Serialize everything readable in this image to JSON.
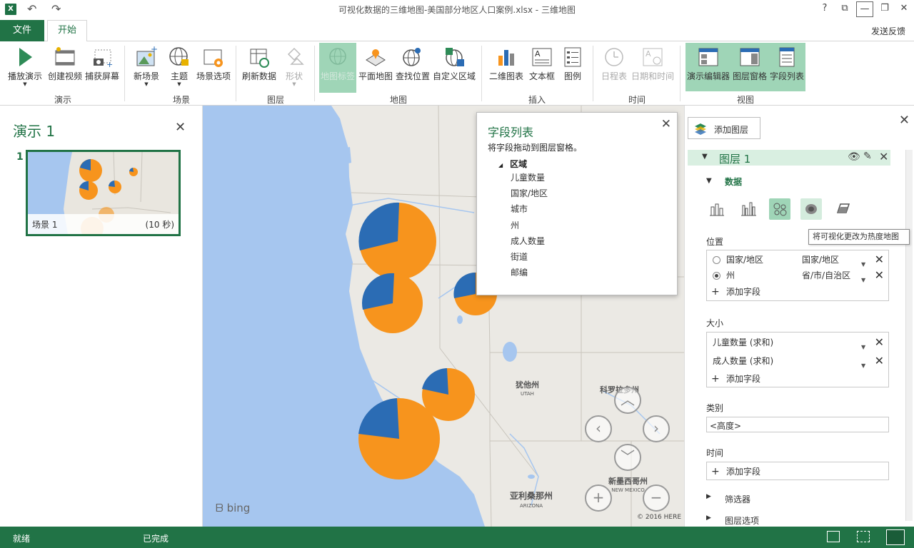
{
  "window": {
    "title": "可视化数据的三维地图-美国部分地区人口案例.xlsx - 三维地图",
    "help": "?",
    "app_icon": "X"
  },
  "tabs": {
    "file": "文件",
    "home": "开始",
    "feedback": "发送反馈"
  },
  "ribbon": {
    "groups": {
      "tour": "演示",
      "scene": "场景",
      "layer": "图层",
      "map": "地图",
      "insert": "插入",
      "time": "时间",
      "view": "视图"
    },
    "buttons": {
      "play_tour": "播放演示",
      "create_video": "创建视频",
      "capture_screen": "捕获屏幕",
      "new_scene": "新场景",
      "theme": "主题",
      "scene_options": "场景选项",
      "refresh_data": "刷新数据",
      "shapes": "形状",
      "map_labels": "地图标签",
      "flat_map": "平面地图",
      "find_location": "查找位置",
      "custom_regions": "自定义区域",
      "chart_2d": "二维图表",
      "text_box": "文本框",
      "legend": "图例",
      "timeline": "日程表",
      "date_time": "日期和时间",
      "tour_editor": "演示编辑器",
      "layer_pane": "图层窗格",
      "field_list": "字段列表"
    }
  },
  "tour": {
    "title": "演示 1",
    "scene_number": "1",
    "scene_name": "场景 1",
    "scene_duration": "(10 秒)"
  },
  "map": {
    "bing": "bing",
    "copyright": "© 2016 HERE",
    "labels": {
      "utah": "犹他州",
      "utah_en": "UTAH",
      "colorado": "科罗拉多州",
      "arizona": "亚利桑那州",
      "arizona_en": "ARIZONA",
      "new_mexico": "新墨西哥州",
      "new_mexico_en": "NEW MEXICO"
    },
    "colors": {
      "water": "#a6c6ef",
      "land": "#ebe9e4",
      "pie_orange": "#f7941d",
      "pie_blue": "#2b6cb4"
    }
  },
  "field_list": {
    "title": "字段列表",
    "hint": "将字段拖动到图层窗格。",
    "group": "区域",
    "fields": [
      "儿童数量",
      "国家/地区",
      "城市",
      "州",
      "成人数量",
      "街道",
      "邮编"
    ]
  },
  "layer_pane": {
    "add_layer": "添加图层",
    "layer_name": "图层 1",
    "data_section": "数据",
    "tooltip": "将可视化更改为热度地图",
    "location_label": "位置",
    "location_rows": [
      {
        "field": "国家/地区",
        "type": "国家/地区"
      },
      {
        "field": "州",
        "type": "省/市/自治区"
      }
    ],
    "add_field": "添加字段",
    "size_label": "大小",
    "size_rows": [
      "儿童数量 (求和)",
      "成人数量 (求和)"
    ],
    "category_label": "类别",
    "category_value": "<高度>",
    "time_label": "时间",
    "filters": "筛选器",
    "layer_options": "图层选项"
  },
  "status": {
    "ready": "就绪",
    "done": "已完成"
  },
  "accent": "#217346"
}
